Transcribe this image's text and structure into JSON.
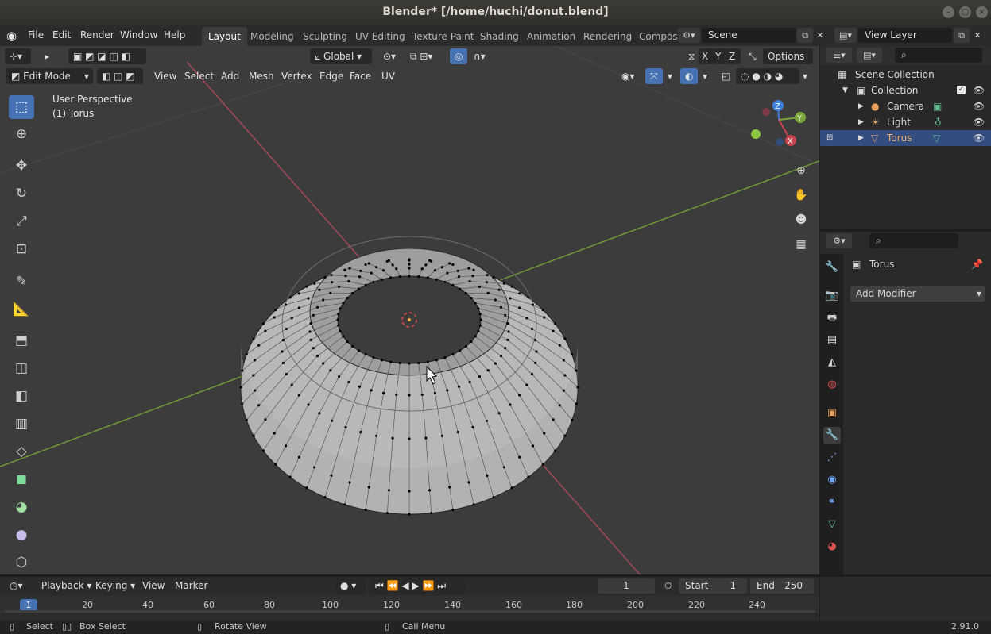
{
  "window": {
    "title": "Blender* [/home/huchi/donut.blend]"
  },
  "menu": {
    "items": [
      "File",
      "Edit",
      "Render",
      "Window",
      "Help"
    ]
  },
  "workspaces": {
    "tabs": [
      "Layout",
      "Modeling",
      "Sculpting",
      "UV Editing",
      "Texture Paint",
      "Shading",
      "Animation",
      "Rendering",
      "Compos"
    ],
    "active": "Layout"
  },
  "scene": {
    "name": "Scene",
    "view_layer": "View Layer"
  },
  "viewport": {
    "mode": "Edit Mode",
    "header_menus": [
      "View",
      "Select",
      "Add",
      "Mesh",
      "Vertex",
      "Edge",
      "Face",
      "UV"
    ],
    "orientation": "Global",
    "options_label": "Options",
    "axes": [
      "X",
      "Y",
      "Z"
    ],
    "overlay_text_line1": "User Perspective",
    "overlay_text_line2": "(1) Torus",
    "gizmo_labels": {
      "z": "Z",
      "y": "Y",
      "x": "X"
    }
  },
  "outliner": {
    "root": "Scene Collection",
    "collection": "Collection",
    "objects": [
      {
        "name": "Camera",
        "selected": false
      },
      {
        "name": "Light",
        "selected": false
      },
      {
        "name": "Torus",
        "selected": true
      }
    ]
  },
  "properties": {
    "object_name": "Torus",
    "add_modifier_label": "Add Modifier"
  },
  "timeline": {
    "menus": [
      "Playback",
      "Keying",
      "View",
      "Marker"
    ],
    "current_frame": "1",
    "start_label": "Start",
    "start_value": "1",
    "end_label": "End",
    "end_value": "250",
    "ruler_current": "1",
    "ruler_ticks": [
      "20",
      "40",
      "60",
      "80",
      "100",
      "120",
      "140",
      "160",
      "180",
      "200",
      "220",
      "240"
    ]
  },
  "status": {
    "select": "Select",
    "box_select": "Box Select",
    "rotate_view": "Rotate View",
    "call_menu": "Call Menu",
    "version": "2.91.0"
  },
  "colors": {
    "accent": "#4772b3",
    "x_axis": "#c8444e",
    "y_axis": "#7aa43a",
    "z_axis": "#3f7fdc",
    "mesh": "#bdbdbd"
  }
}
